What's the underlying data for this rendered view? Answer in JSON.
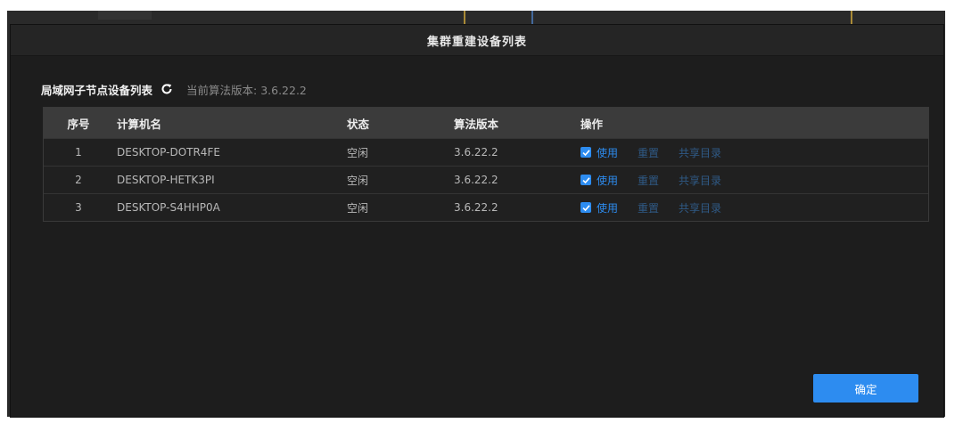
{
  "dialog": {
    "title": "集群重建设备列表",
    "section_title": "局域网子节点设备列表",
    "version_label": "当前算法版本: 3.6.22.2",
    "confirm_label": "确定"
  },
  "table": {
    "headers": {
      "index": "序号",
      "computer_name": "计算机名",
      "status": "状态",
      "algo_version": "算法版本",
      "operations": "操作"
    },
    "rows": [
      {
        "index": "1",
        "name": "DESKTOP-DOTR4FE",
        "status": "空闲",
        "version": "3.6.22.2",
        "use": "使用",
        "reset": "重置",
        "share": "共享目录",
        "checked": true
      },
      {
        "index": "2",
        "name": "DESKTOP-HETK3PI",
        "status": "空闲",
        "version": "3.6.22.2",
        "use": "使用",
        "reset": "重置",
        "share": "共享目录",
        "checked": true
      },
      {
        "index": "3",
        "name": "DESKTOP-S4HHP0A",
        "status": "空闲",
        "version": "3.6.22.2",
        "use": "使用",
        "reset": "重置",
        "share": "共享目录",
        "checked": true
      }
    ]
  },
  "icons": {
    "refresh": "refresh-icon",
    "checkbox": "checkbox-checked-icon"
  },
  "colors": {
    "accent": "#2d8cf0",
    "link_dim": "#2f5a86",
    "modal_bg": "#1d1d1d",
    "header_bg": "#3b3b3b"
  }
}
